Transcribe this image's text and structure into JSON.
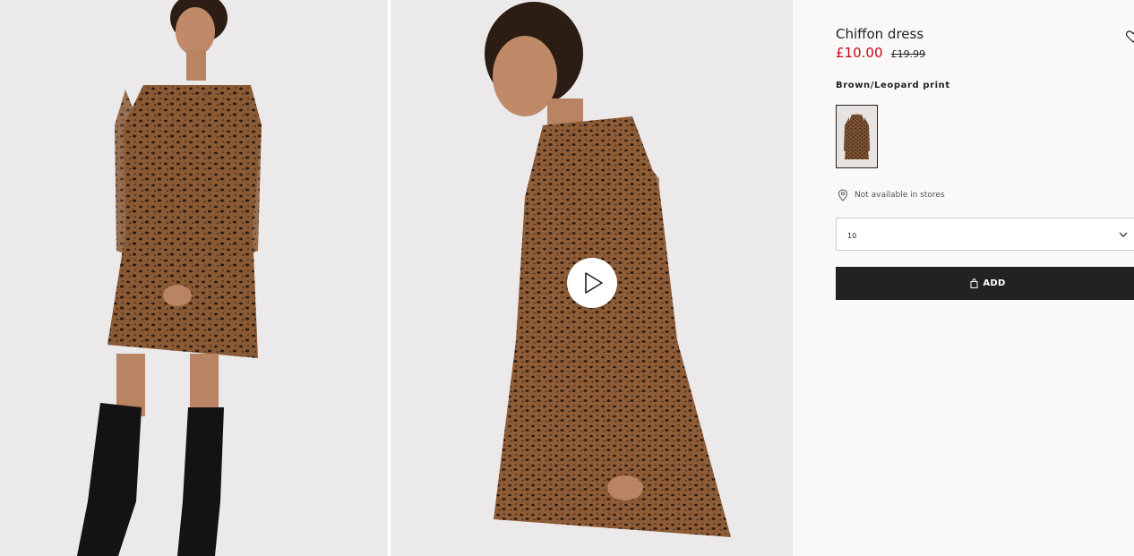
{
  "product": {
    "title": "Chiffon dress",
    "price": "£10.00",
    "old_price": "£19.99",
    "price_color": "#d0021b"
  },
  "color": {
    "name": "Brown/Leopard print"
  },
  "availability": {
    "text": "Not available in stores",
    "icon": "location-pin-icon"
  },
  "size_select": {
    "value": "10",
    "icon": "chevron-down-icon"
  },
  "add_button": {
    "label": "ADD",
    "icon": "shopping-bag-icon",
    "background": "#222222"
  },
  "gallery": {
    "play_icon": "play-icon",
    "wishlist_icon": "heart-icon"
  }
}
